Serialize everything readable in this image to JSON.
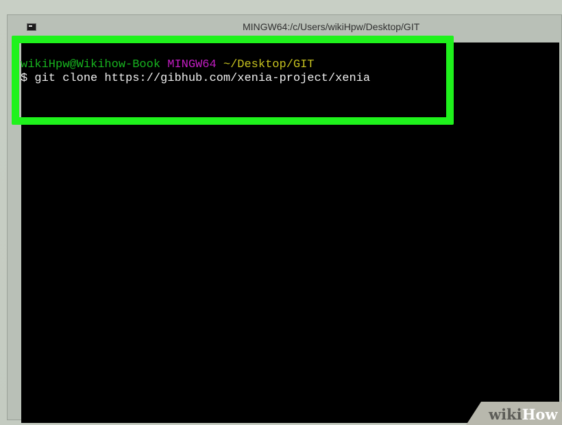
{
  "window": {
    "title": "MINGW64:/c/Users/wikiHpw/Desktop/GIT",
    "icon": "cmd-icon"
  },
  "terminal": {
    "prompt_user": "wikiHpw@Wikihow-Book",
    "prompt_system": "MINGW64",
    "prompt_path": "~/Desktop/GIT",
    "command_prefix": "$",
    "command": "git clone https://gibhub.com/xenia-project/xenia"
  },
  "watermark": {
    "wiki": "wiki",
    "how": "How"
  },
  "colors": {
    "highlight": "#1ff21c",
    "prompt_user": "#17b31f",
    "prompt_system": "#c21dc2",
    "prompt_path": "#c7c21f",
    "terminal_bg": "#000000"
  }
}
